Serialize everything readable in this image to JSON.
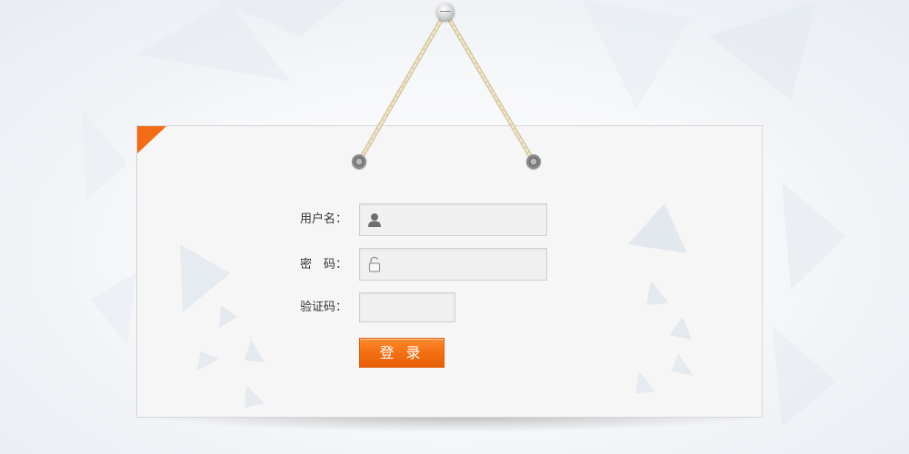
{
  "form": {
    "username": {
      "label": "用户名：",
      "value": "",
      "icon": "user-icon"
    },
    "password": {
      "label": "密　码：",
      "value": "",
      "icon": "lock-icon"
    },
    "captcha": {
      "label": "验证码：",
      "value": ""
    },
    "submit_label": "登 录"
  },
  "colors": {
    "accent": "#f36b14",
    "board": "#f6f6f6",
    "field_bg": "#f0f0f0",
    "field_border": "#cfcfcf",
    "string": "#e8dcc0"
  }
}
